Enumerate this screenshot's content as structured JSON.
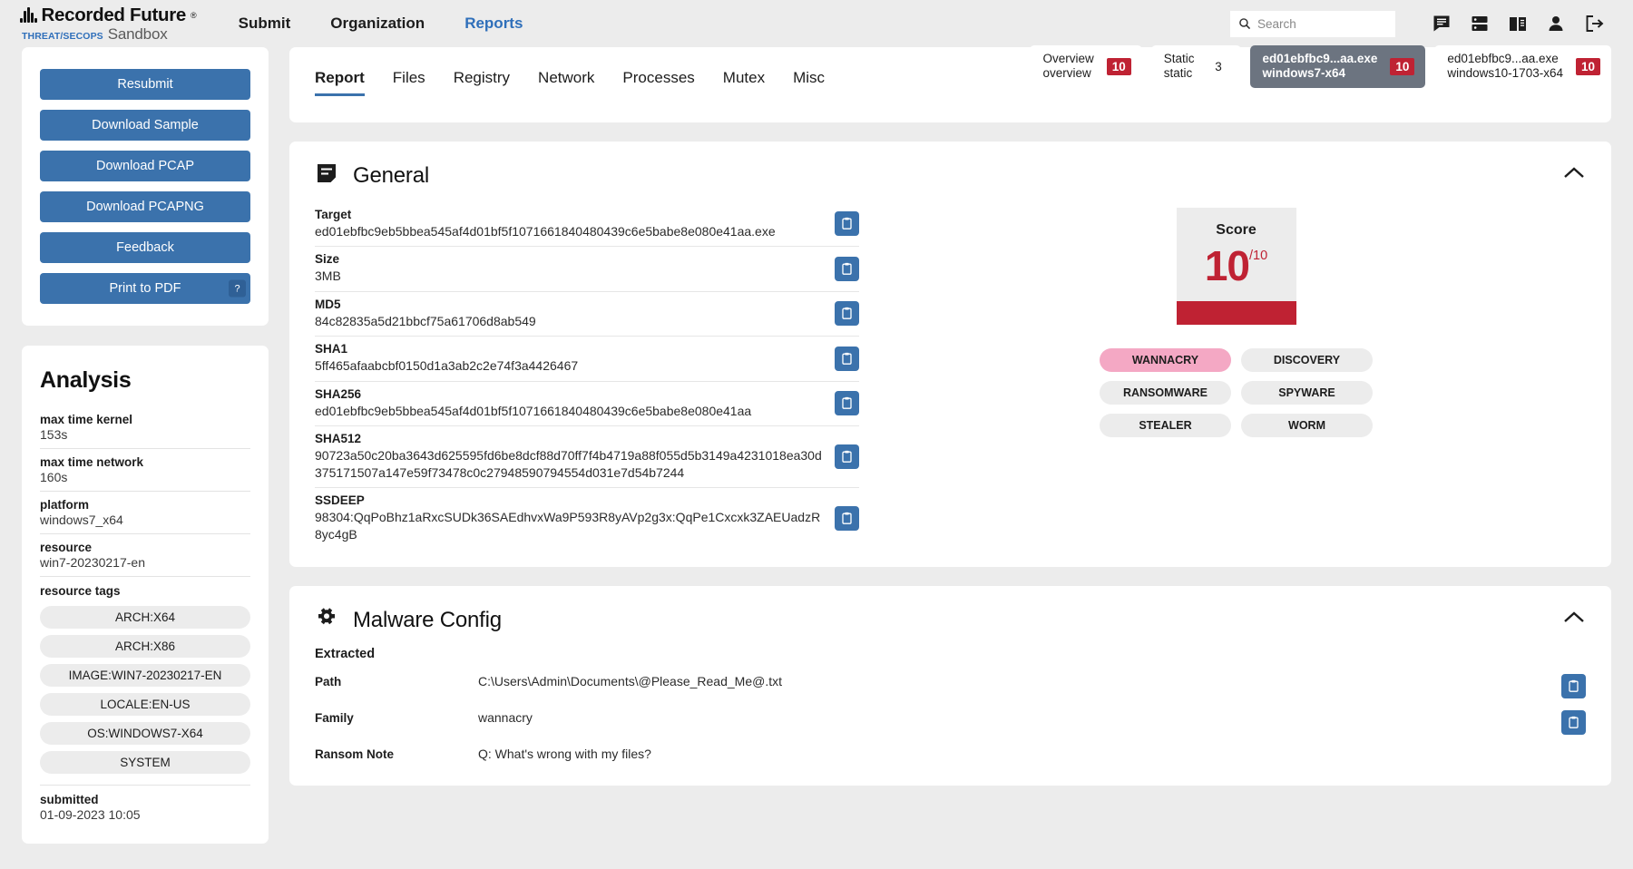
{
  "brand": {
    "name": "Recorded Future",
    "registered": "®",
    "threat_secops": "THREAT/SECOPS",
    "product": "Sandbox"
  },
  "nav": {
    "items": [
      {
        "label": "Submit",
        "active": false
      },
      {
        "label": "Organization",
        "active": false
      },
      {
        "label": "Reports",
        "active": true
      }
    ]
  },
  "search": {
    "value": "",
    "placeholder": "Search"
  },
  "header_icons": [
    {
      "name": "chat-icon"
    },
    {
      "name": "server-icon"
    },
    {
      "name": "book-icon"
    },
    {
      "name": "user-icon"
    },
    {
      "name": "logout-icon"
    }
  ],
  "analysis_tabs": [
    {
      "line1": "Overview",
      "line2": "overview",
      "badge": "10",
      "badge_style": "red",
      "selected": false
    },
    {
      "line1": "Static",
      "line2": "static",
      "badge": "3",
      "badge_style": "plain",
      "selected": false
    },
    {
      "line1": "ed01ebfbc9...aa.exe",
      "line2": "windows7-x64",
      "badge": "10",
      "badge_style": "red",
      "selected": true
    },
    {
      "line1": "ed01ebfbc9...aa.exe",
      "line2": "windows10-1703-x64",
      "badge": "10",
      "badge_style": "red",
      "selected": false
    }
  ],
  "sidebar": {
    "buttons": [
      {
        "label": "Resubmit",
        "help": false
      },
      {
        "label": "Download Sample",
        "help": false
      },
      {
        "label": "Download PCAP",
        "help": false
      },
      {
        "label": "Download PCAPNG",
        "help": false
      },
      {
        "label": "Feedback",
        "help": false
      },
      {
        "label": "Print to PDF",
        "help": true,
        "help_glyph": "?"
      }
    ],
    "analysis": {
      "title": "Analysis",
      "rows": [
        {
          "key": "max time kernel",
          "value": "153s"
        },
        {
          "key": "max time network",
          "value": "160s"
        },
        {
          "key": "platform",
          "value": "windows7_x64"
        },
        {
          "key": "resource",
          "value": "win7-20230217-en"
        }
      ],
      "tags_label": "resource tags",
      "tags": [
        "ARCH:X64",
        "ARCH:X86",
        "IMAGE:WIN7-20230217-EN",
        "LOCALE:EN-US",
        "OS:WINDOWS7-X64",
        "SYSTEM"
      ],
      "submitted_label": "submitted",
      "submitted_value": "01-09-2023 10:05"
    }
  },
  "report_tabs": [
    {
      "label": "Report",
      "active": true
    },
    {
      "label": "Files",
      "active": false
    },
    {
      "label": "Registry",
      "active": false
    },
    {
      "label": "Network",
      "active": false
    },
    {
      "label": "Processes",
      "active": false
    },
    {
      "label": "Mutex",
      "active": false
    },
    {
      "label": "Misc",
      "active": false
    }
  ],
  "general": {
    "icon": "document-icon",
    "title": "General",
    "collapse_icon": "chevron-up-icon",
    "rows": [
      {
        "key": "Target",
        "value": "ed01ebfbc9eb5bbea545af4d01bf5f1071661840480439c6e5babe8e080e41aa.exe"
      },
      {
        "key": "Size",
        "value": "3MB"
      },
      {
        "key": "MD5",
        "value": "84c82835a5d21bbcf75a61706d8ab549"
      },
      {
        "key": "SHA1",
        "value": "5ff465afaabcbf0150d1a3ab2c2e74f3a4426467"
      },
      {
        "key": "SHA256",
        "value": "ed01ebfbc9eb5bbea545af4d01bf5f1071661840480439c6e5babe8e080e41aa"
      },
      {
        "key": "SHA512",
        "value": "90723a50c20ba3643d625595fd6be8dcf88d70ff7f4b4719a88f055d5b3149a4231018ea30d375171507a147e59f73478c0c27948590794554d031e7d54b7244"
      },
      {
        "key": "SSDEEP",
        "value": "98304:QqPoBhz1aRxcSUDk36SAEdhvxWa9P593R8yAVp2g3x:QqPe1Cxcxk3ZAEUadzR8yc4gB"
      }
    ],
    "copy_icon": "clipboard-icon",
    "score": {
      "label": "Score",
      "value": "10",
      "denominator": "/10",
      "bar_color": "#bf2233"
    },
    "classification_tags": [
      {
        "label": "WANNACRY",
        "highlight": true
      },
      {
        "label": "DISCOVERY",
        "highlight": false
      },
      {
        "label": "RANSOMWARE",
        "highlight": false
      },
      {
        "label": "SPYWARE",
        "highlight": false
      },
      {
        "label": "STEALER",
        "highlight": false
      },
      {
        "label": "WORM",
        "highlight": false
      }
    ]
  },
  "malware_config": {
    "icon": "gear-icon",
    "title": "Malware Config",
    "collapse_icon": "chevron-up-icon",
    "extracted_label": "Extracted",
    "rows": [
      {
        "key": "Path",
        "value": "C:\\Users\\Admin\\Documents\\@Please_Read_Me@.txt",
        "copy": true
      },
      {
        "key": "Family",
        "value": "wannacry",
        "copy": true
      },
      {
        "key": "Ransom Note",
        "value": "Q:  What's wrong with my files?",
        "copy": false
      }
    ],
    "copy_icon": "clipboard-icon"
  },
  "colors": {
    "accent_blue": "#3b72ac",
    "link_blue": "#2f6fba",
    "danger_red": "#bf2233",
    "selected_tab": "#6c7480",
    "highlight_pink": "#f4a8c4",
    "page_bg": "#ececec"
  }
}
